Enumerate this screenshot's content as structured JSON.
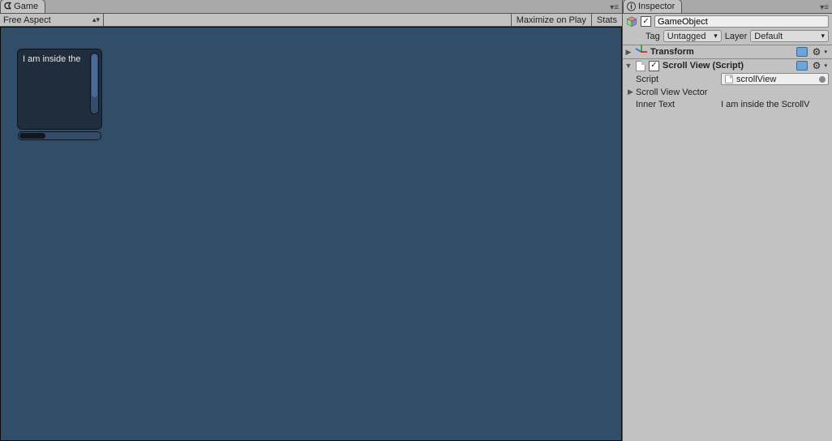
{
  "game": {
    "tab_label": "Game",
    "aspect_label": "Free Aspect",
    "maximize_label": "Maximize on Play",
    "stats_label": "Stats",
    "scrollview_text": "I am inside the"
  },
  "inspector": {
    "tab_label": "Inspector",
    "gameobject_name": "GameObject",
    "tag_label": "Tag",
    "tag_value": "Untagged",
    "layer_label": "Layer",
    "layer_value": "Default",
    "components": {
      "transform_title": "Transform",
      "scrollview_title": "Scroll View (Script)",
      "script_label": "Script",
      "script_value": "scrollView",
      "vector_label": "Scroll View Vector",
      "innertext_label": "Inner Text",
      "innertext_value": "I am inside the ScrollV"
    }
  }
}
